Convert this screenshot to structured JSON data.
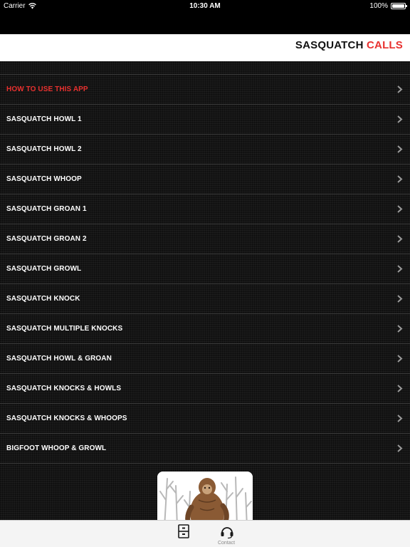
{
  "status_bar": {
    "carrier": "Carrier",
    "time": "10:30 AM",
    "battery": "100%",
    "battery_level": 1.0,
    "wifi_icon": "wifi-icon"
  },
  "header": {
    "title_part1": "SASQUATCH",
    "title_part2": "CALLS",
    "accent_color": "#e8312f"
  },
  "list": {
    "chevron_icon": "chevron-right-icon",
    "items": [
      {
        "label": "HOW TO USE THIS APP",
        "highlight": true
      },
      {
        "label": "SASQUATCH HOWL 1"
      },
      {
        "label": "SASQUATCH HOWL 2"
      },
      {
        "label": "SASQUATCH WHOOP"
      },
      {
        "label": "SASQUATCH GROAN 1"
      },
      {
        "label": "SASQUATCH GROAN 2"
      },
      {
        "label": "SASQUATCH GROWL"
      },
      {
        "label": "SASQUATCH KNOCK"
      },
      {
        "label": "SASQUATCH MULTIPLE KNOCKS"
      },
      {
        "label": "SASQUATCH HOWL & GROAN"
      },
      {
        "label": "SASQUATCH KNOCKS & HOWLS"
      },
      {
        "label": "SASQUATCH KNOCKS & WHOOPS"
      },
      {
        "label": "BIGFOOT WHOOP & GROWL"
      }
    ]
  },
  "banner": {
    "image": "sasquatch-illustration"
  },
  "tab_bar": {
    "tabs": [
      {
        "label": "",
        "icon": "cabinet-icon"
      },
      {
        "label": "Contact",
        "icon": "headset-icon"
      }
    ]
  }
}
